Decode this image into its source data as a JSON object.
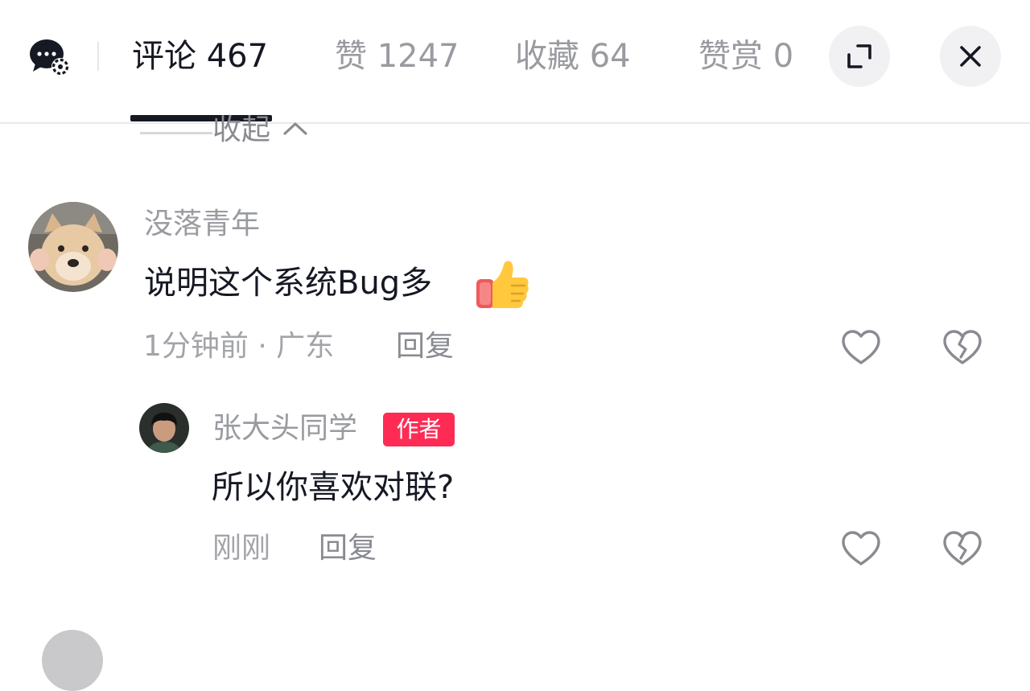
{
  "header": {
    "tabs": [
      {
        "label": "评论 467",
        "active": true
      },
      {
        "label": "赞 1247",
        "active": false
      },
      {
        "label": "收藏 64",
        "active": false
      },
      {
        "label": "赞赏 0",
        "active": false
      }
    ],
    "icons": {
      "left": "comment-bubble-gear-icon",
      "expand": "expand-icon",
      "close": "close-icon"
    }
  },
  "collapse": {
    "label": "收起",
    "icon": "chevron-up-icon"
  },
  "comments": [
    {
      "username": "没落青年",
      "text": "说明这个系统Bug多",
      "emoji": "thumbs-up-icon",
      "meta": "1分钟前 · 广东",
      "reply_label": "回复",
      "replies": [
        {
          "username": "张大头同学",
          "badge": "作者",
          "text": "所以你喜欢对联?",
          "meta": "刚刚",
          "reply_label": "回复"
        }
      ]
    }
  ],
  "colors": {
    "accent": "#fe2c55",
    "text": "#161823",
    "muted": "#9a9ba0",
    "divider": "#e9e9ec"
  }
}
